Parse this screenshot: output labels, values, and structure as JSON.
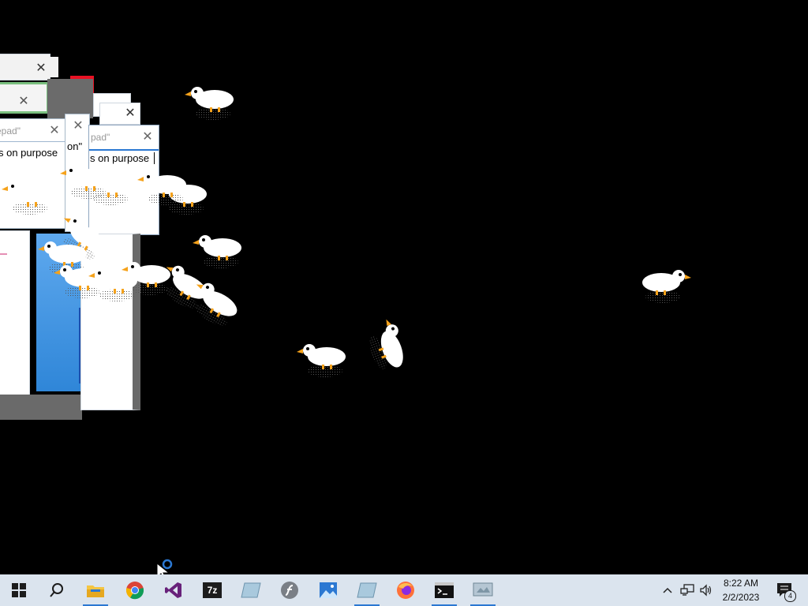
{
  "windows": {
    "win_a": {
      "title": "epad\"",
      "text": "s on purpose"
    },
    "win_b": {
      "title": "on\""
    },
    "win_c": {
      "title": "pad\"",
      "text": "s on purpose"
    }
  },
  "taskbar": {
    "items": [
      {
        "name": "start-button",
        "icon": "windows-logo-icon"
      },
      {
        "name": "search-button",
        "icon": "search-icon"
      },
      {
        "name": "file-explorer",
        "icon": "folder-icon",
        "active": true
      },
      {
        "name": "chrome",
        "icon": "chrome-icon"
      },
      {
        "name": "visual-studio",
        "icon": "visual-studio-icon"
      },
      {
        "name": "7zip",
        "icon": "7zip-icon",
        "label": "7z"
      },
      {
        "name": "app-glass",
        "icon": "glass-tile-icon"
      },
      {
        "name": "flash",
        "icon": "flash-icon"
      },
      {
        "name": "photos",
        "icon": "photos-icon"
      },
      {
        "name": "app-glass-2",
        "icon": "glass-tile-icon",
        "active": true
      },
      {
        "name": "firefox",
        "icon": "firefox-icon"
      },
      {
        "name": "terminal",
        "icon": "terminal-icon",
        "active": true
      },
      {
        "name": "app-desktop-goose",
        "icon": "monitor-icon",
        "active": true
      }
    ],
    "clock": {
      "time": "8:22 AM",
      "date": "2/2/2023"
    },
    "notification_count": "4"
  },
  "colors": {
    "accent": "#2b78d2",
    "taskbar_bg": "#dbe4ee",
    "close_red": "#e81123"
  }
}
